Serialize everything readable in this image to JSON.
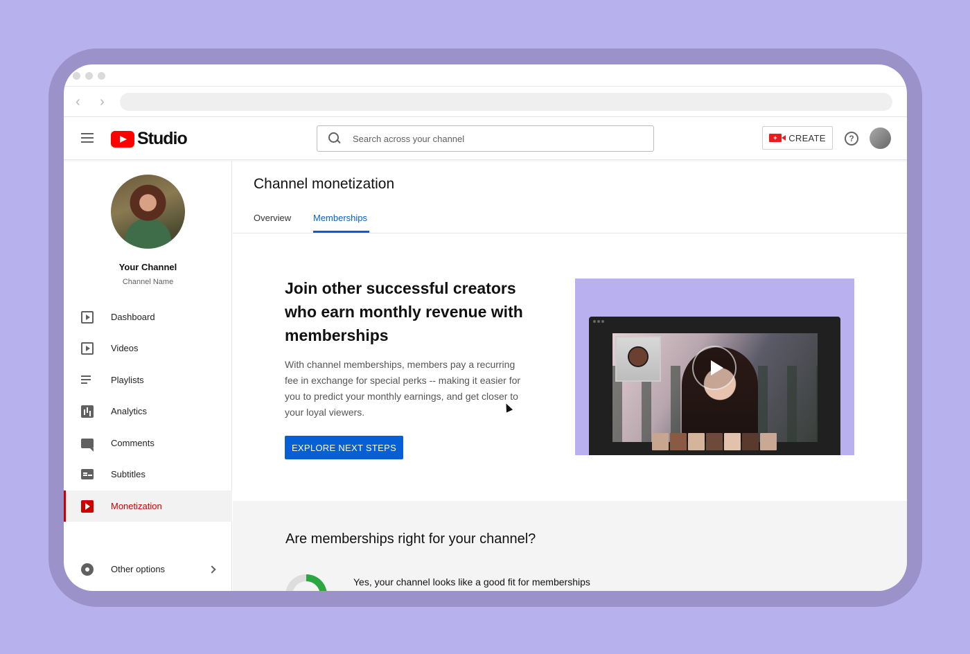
{
  "header": {
    "logo_text": "Studio",
    "search_placeholder": "Search across your channel",
    "create_label": "CREATE",
    "help_glyph": "?"
  },
  "sidebar": {
    "channel_title": "Your Channel",
    "channel_name": "Channel Name",
    "items": [
      {
        "label": "Dashboard",
        "icon": "dashboard-icon"
      },
      {
        "label": "Videos",
        "icon": "videos-icon"
      },
      {
        "label": "Playlists",
        "icon": "playlists-icon"
      },
      {
        "label": "Analytics",
        "icon": "analytics-icon"
      },
      {
        "label": "Comments",
        "icon": "comments-icon"
      },
      {
        "label": "Subtitles",
        "icon": "subtitles-icon"
      },
      {
        "label": "Monetization",
        "icon": "monetization-icon",
        "active": true
      }
    ],
    "other_options": "Other options"
  },
  "main": {
    "page_title": "Channel monetization",
    "tabs": [
      {
        "label": "Overview"
      },
      {
        "label": "Memberships",
        "active": true
      }
    ],
    "hero_title": "Join other successful creators who earn monthly revenue with memberships",
    "hero_description": "With channel memberships, members pay a recurring fee in exchange for special perks -- making it easier for you to predict your monthly earnings, and get closer to your loyal viewers.",
    "explore_button": "EXPLORE NEXT STEPS",
    "section_title": "Are memberships right for your channel?",
    "fit_text": "Yes, your channel looks like a good fit for memberships"
  },
  "colors": {
    "accent": "#065fd4",
    "brand_red": "#ff0000",
    "active_red": "#cc0000",
    "background": "#b7b2ee"
  }
}
